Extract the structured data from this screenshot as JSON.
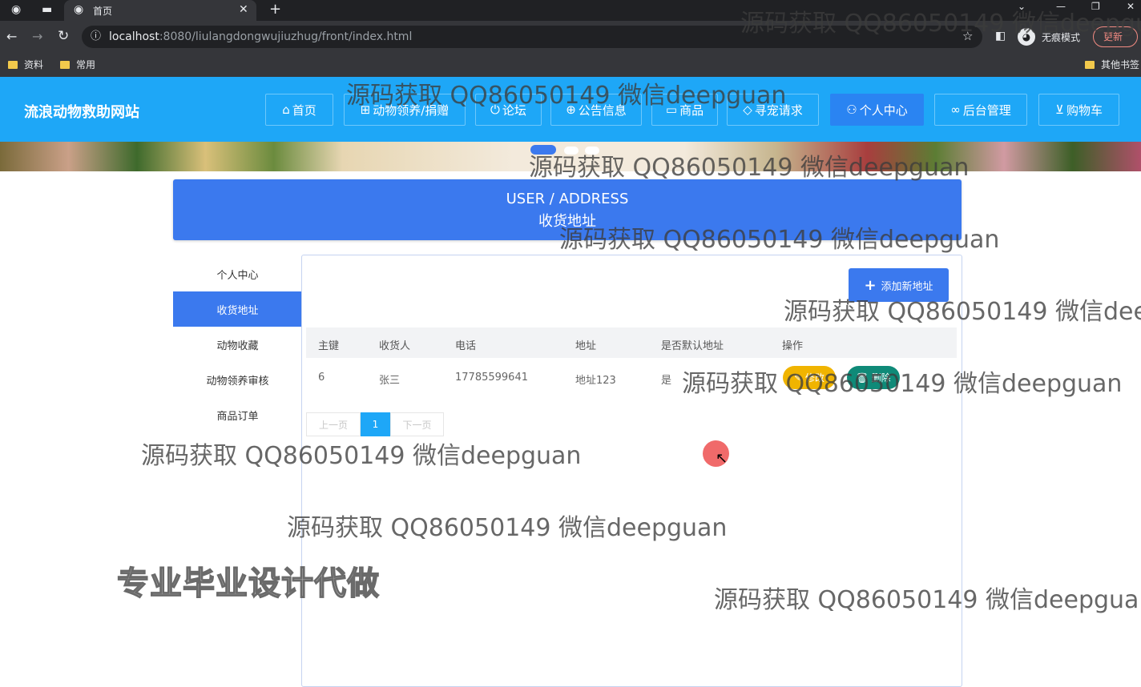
{
  "browser": {
    "tab_title": "首页",
    "url_host": "localhost",
    "url_rest": ":8080/liulangdongwujiuzhug/front/index.html",
    "incognito_label": "无痕模式",
    "update_label": "更新",
    "bookmarks": [
      "资料",
      "常用"
    ],
    "other_bookmarks": "其他书签"
  },
  "site": {
    "title": "流浪动物救助网站",
    "nav": [
      {
        "icon": "home-icon",
        "glyph": "⌂",
        "label": "首页"
      },
      {
        "icon": "adopt-icon",
        "glyph": "⊞",
        "label": "动物领养/捐赠"
      },
      {
        "icon": "power-icon",
        "glyph": "⏻",
        "label": "论坛"
      },
      {
        "icon": "globe-icon",
        "glyph": "⊕",
        "label": "公告信息"
      },
      {
        "icon": "book-icon",
        "glyph": "▭",
        "label": "商品"
      },
      {
        "icon": "tag-icon",
        "glyph": "◇",
        "label": "寻宠请求"
      },
      {
        "icon": "user-icon",
        "glyph": "⚇",
        "label": "个人中心"
      },
      {
        "icon": "link-icon",
        "glyph": "∞",
        "label": "后台管理"
      },
      {
        "icon": "cart-icon",
        "glyph": "⊻",
        "label": "购物车"
      }
    ]
  },
  "heading": {
    "en": "USER / ADDRESS",
    "zh": "收货地址"
  },
  "sidebar": [
    "个人中心",
    "收货地址",
    "动物收藏",
    "动物领养审核",
    "商品订单"
  ],
  "add_button": "添加新地址",
  "table": {
    "headers": [
      "主键",
      "收货人",
      "电话",
      "地址",
      "是否默认地址",
      "操作"
    ],
    "rows": [
      {
        "id": "6",
        "name": "张三",
        "phone": "17785599641",
        "address": "地址123",
        "default": "是"
      }
    ],
    "edit_label": "修改",
    "delete_label": "删除"
  },
  "pagination": {
    "prev": "上一页",
    "current": "1",
    "next": "下一页"
  },
  "watermark": "源码获取 QQ86050149 微信deepguan",
  "promo": "专业毕业设计代做"
}
